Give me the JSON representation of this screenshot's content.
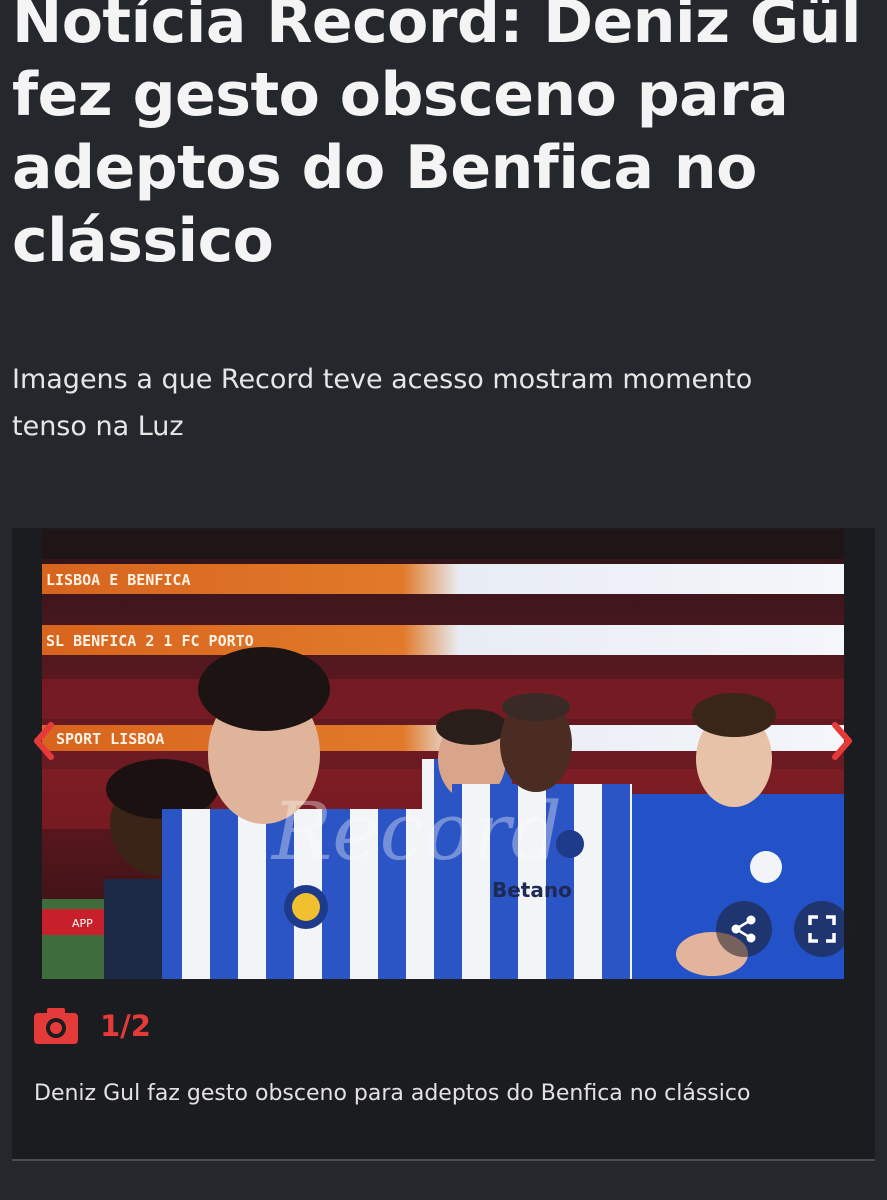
{
  "article": {
    "headline": "Notícia Record: Deniz Gül fez gesto obsceno para adeptos do Benfica no clássico",
    "subtitle": "Imagens a que Record teve acesso mostram momento tenso na Luz"
  },
  "gallery": {
    "counter": "1/2",
    "caption": "Deniz Gul faz gesto obsceno para adeptos do Benfica no clássico",
    "photo": {
      "led_banner_top": "LISBOA E BENFICA",
      "led_banner_score": "SL BENFICA 2 1 FC PORTO",
      "led_banner_mid": "SPORT LISBOA",
      "shirt_sponsor": "Betano",
      "watermark": "Record",
      "pitch_board": "APP"
    },
    "icons": {
      "prev": "chevron-left-icon",
      "next": "chevron-right-icon",
      "camera": "camera-icon",
      "share": "share-icon",
      "fullscreen": "fullscreen-icon"
    }
  },
  "colors": {
    "background": "#24272b",
    "accent": "#e53a3a",
    "gallery_bg": "#1b1c1f"
  }
}
